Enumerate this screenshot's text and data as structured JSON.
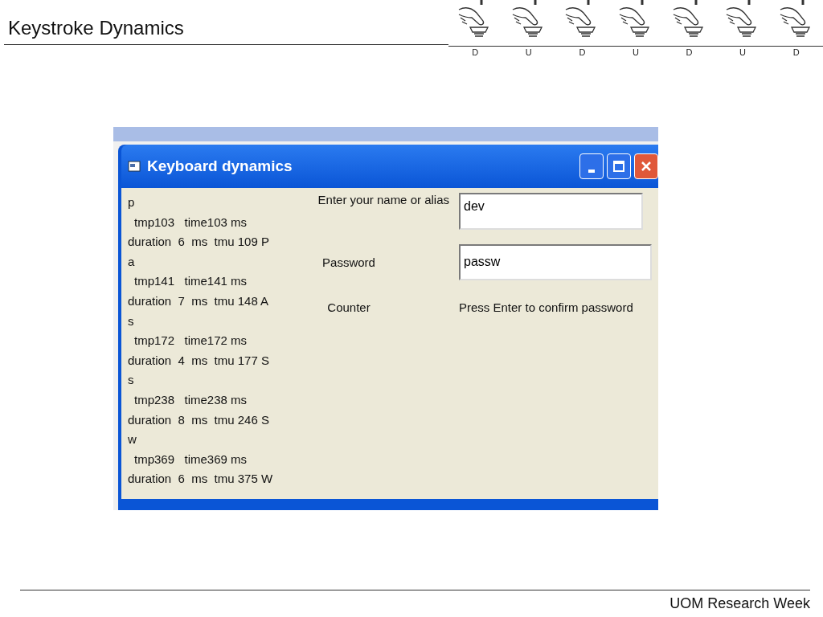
{
  "slide": {
    "title": "Keystroke Dynamics",
    "footer": "UOM Research Week"
  },
  "keystrokes": [
    {
      "label": "D"
    },
    {
      "label": "U"
    },
    {
      "label": "D"
    },
    {
      "label": "U"
    },
    {
      "label": "D"
    },
    {
      "label": "U"
    },
    {
      "label": "D"
    }
  ],
  "window": {
    "title": "Keyboard dynamics",
    "log": [
      {
        "key": "p",
        "time": "tmp103   time103 ms",
        "duration": "duration  6  ms  tmu 109 P"
      },
      {
        "key": "a",
        "time": "tmp141   time141 ms",
        "duration": "duration  7  ms  tmu 148 A"
      },
      {
        "key": "s",
        "time": "tmp172   time172 ms",
        "duration": "duration  4  ms  tmu 177 S"
      },
      {
        "key": "s",
        "time": "tmp238   time238 ms",
        "duration": "duration  8  ms  tmu 246 S"
      },
      {
        "key": "w",
        "time": "tmp369   time369 ms",
        "duration": "duration  6  ms  tmu 375 W"
      }
    ],
    "fields": [
      {
        "kind": "input",
        "label": "Enter your name or alias",
        "value": "dev"
      },
      {
        "kind": "input",
        "label": "Password",
        "value": "passw"
      },
      {
        "kind": "text",
        "label": "Counter",
        "value": "Press Enter to confirm password"
      }
    ]
  }
}
